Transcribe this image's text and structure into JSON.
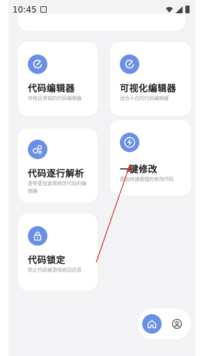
{
  "status_bar": {
    "time": "10:45"
  },
  "cards": [
    {
      "title": "代码编辑器",
      "desc": "传统且常规的代码编辑器"
    },
    {
      "title": "可视化编辑器",
      "desc": "适合小白的代码编辑器"
    },
    {
      "title": "代码逐行解析",
      "desc": "更够更加直观修改代码的编辑器"
    },
    {
      "title": "一键修改",
      "desc": "更加快速便捷的修改代码"
    },
    {
      "title": "代码锁定",
      "desc": "防止代码被游戏自动还原"
    }
  ],
  "colors": {
    "accent": "#6a8fe6",
    "background": "#f3f3f6",
    "card": "#ffffff",
    "annotation_arrow": "#c0392b"
  },
  "icons": [
    "edit-icon",
    "edit-icon",
    "bubbles-icon",
    "lightning-icon",
    "lock-icon",
    "home-icon",
    "profile-icon"
  ]
}
